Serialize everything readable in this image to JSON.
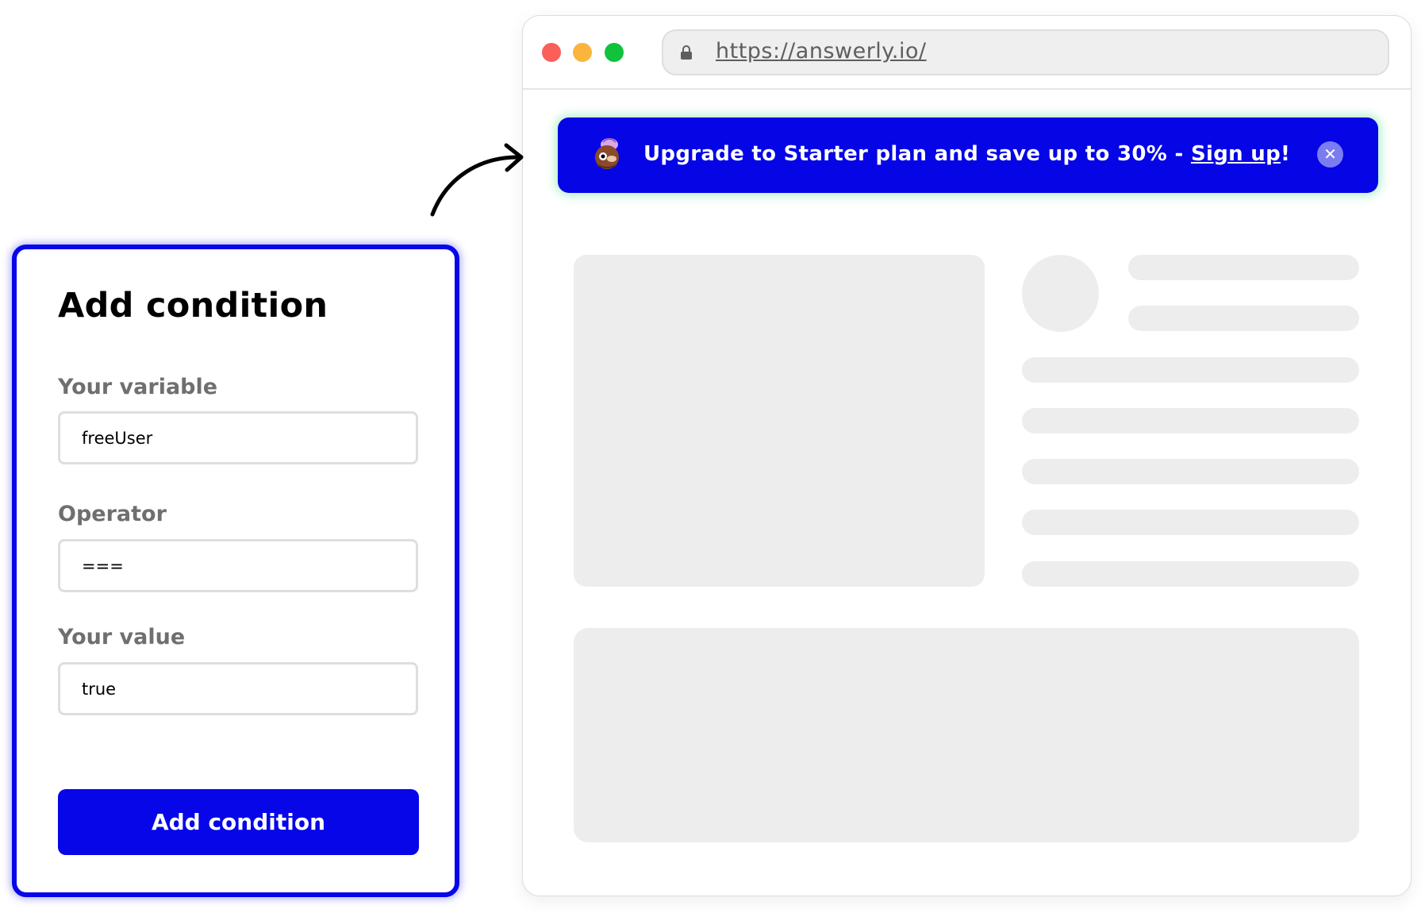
{
  "browser": {
    "url": "https://answerly.io/",
    "window_controls": {
      "close_color": "#fb5f59",
      "minimize_color": "#fbb53d",
      "maximize_color": "#10c23c"
    }
  },
  "banner": {
    "message": "Upgrade to Starter plan and save up to 30% - ",
    "link_label": "Sign up",
    "trailing": "!",
    "close_symbol": "✕",
    "background_color": "#0605e6",
    "icon": "mascot-icon"
  },
  "form": {
    "title": "Add condition",
    "variable_label": "Your variable",
    "variable_value": "freeUser",
    "operator_label": "Operator",
    "operator_value": "===",
    "value_label": "Your value",
    "value_value": "true",
    "submit_label": "Add condition",
    "accent_color": "#0606e8"
  }
}
